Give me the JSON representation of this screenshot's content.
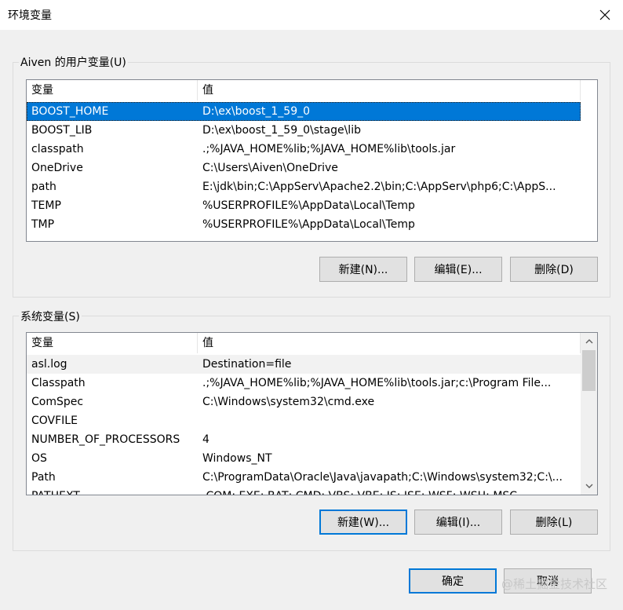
{
  "window": {
    "title": "环境变量",
    "close_icon": "close-icon"
  },
  "user_vars": {
    "group_label": "Aiven 的用户变量(U)",
    "columns": [
      "变量",
      "值"
    ],
    "rows": [
      {
        "name": "BOOST_HOME",
        "value": "D:\\ex\\boost_1_59_0"
      },
      {
        "name": "BOOST_LIB",
        "value": "D:\\ex\\boost_1_59_0\\stage\\lib"
      },
      {
        "name": "classpath",
        "value": ".;%JAVA_HOME%lib;%JAVA_HOME%lib\\tools.jar"
      },
      {
        "name": "OneDrive",
        "value": "C:\\Users\\Aiven\\OneDrive"
      },
      {
        "name": "path",
        "value": "E:\\jdk\\bin;C:\\AppServ\\Apache2.2\\bin;C:\\AppServ\\php6;C:\\AppS..."
      },
      {
        "name": "TEMP",
        "value": "%USERPROFILE%\\AppData\\Local\\Temp"
      },
      {
        "name": "TMP",
        "value": "%USERPROFILE%\\AppData\\Local\\Temp"
      }
    ],
    "selected_index": 0,
    "buttons": {
      "new": "新建(N)...",
      "edit": "编辑(E)...",
      "delete": "删除(D)"
    }
  },
  "system_vars": {
    "group_label": "系统变量(S)",
    "columns": [
      "变量",
      "值"
    ],
    "rows": [
      {
        "name": "asl.log",
        "value": "Destination=file"
      },
      {
        "name": "Classpath",
        "value": ".;%JAVA_HOME%lib;%JAVA_HOME%lib\\tools.jar;c:\\Program File..."
      },
      {
        "name": "ComSpec",
        "value": "C:\\Windows\\system32\\cmd.exe"
      },
      {
        "name": "COVFILE",
        "value": ""
      },
      {
        "name": "NUMBER_OF_PROCESSORS",
        "value": "4"
      },
      {
        "name": "OS",
        "value": "Windows_NT"
      },
      {
        "name": "Path",
        "value": "C:\\ProgramData\\Oracle\\Java\\javapath;C:\\Windows\\system32;C:\\..."
      },
      {
        "name": "PATHEXT",
        "value": ".COM;.EXE;.BAT;.CMD;.VBS;.VBE;.JS;.JSE;.WSF;.WSH;.MSC"
      }
    ],
    "hover_index": 0,
    "scroll_up_icon": "chevron-up-icon",
    "scroll_down_icon": "chevron-down-icon",
    "buttons": {
      "new": "新建(W)...",
      "edit": "编辑(I)...",
      "delete": "删除(L)"
    }
  },
  "footer": {
    "ok": "确定",
    "cancel": "取消"
  },
  "watermark": "@稀土掘金技术社区"
}
